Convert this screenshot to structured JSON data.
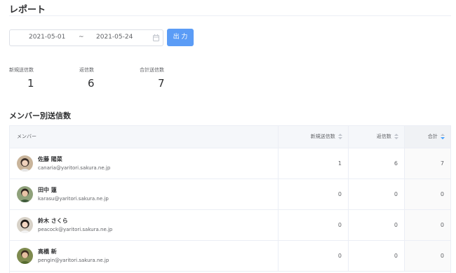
{
  "header": {
    "title": "レポート"
  },
  "filter": {
    "start_date": "2021-05-01",
    "separator": "~",
    "end_date": "2021-05-24",
    "export_label": "出 力"
  },
  "stats": [
    {
      "label": "新規送信数",
      "value": "1"
    },
    {
      "label": "返信数",
      "value": "6"
    },
    {
      "label": "合計送信数",
      "value": "7"
    }
  ],
  "section": {
    "title": "メンバー別送信数"
  },
  "table": {
    "columns": [
      "メンバー",
      "新規送信数",
      "返信数",
      "合計"
    ],
    "sorted_column": "合計",
    "rows": [
      {
        "name": "佐藤 陽菜",
        "email": "canaria@yaritori.sakura.ne.jp",
        "new": "1",
        "reply": "6",
        "total": "7"
      },
      {
        "name": "田中 蓮",
        "email": "karasu@yaritori.sakura.ne.jp",
        "new": "0",
        "reply": "0",
        "total": "0"
      },
      {
        "name": "鈴木 さくら",
        "email": "peacock@yaritori.sakura.ne.jp",
        "new": "0",
        "reply": "0",
        "total": "0"
      },
      {
        "name": "高橋 新",
        "email": "pengin@yaritori.sakura.ne.jp",
        "new": "0",
        "reply": "0",
        "total": "0"
      }
    ]
  },
  "colors": {
    "accent": "#5b9cf6",
    "border": "#ebeef5",
    "header_bg": "#f5f7fa"
  },
  "icons": [
    "calendar-icon",
    "sort-icon",
    "sort-desc-active-icon",
    "avatar"
  ]
}
